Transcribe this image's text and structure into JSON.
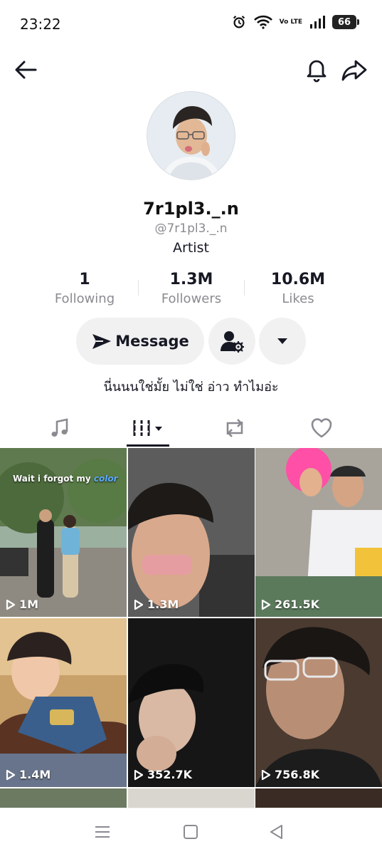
{
  "status_bar": {
    "time": "23:22",
    "network": "Vo LTE",
    "battery": "66"
  },
  "profile": {
    "display_name": "7r1pl3._.n",
    "username": "@7r1pl3._.n",
    "category": "Artist",
    "bio": "นี่นนนใช่มั้ย ไม่ใช่ อ่าว ทำไมอ่ะ"
  },
  "stats": [
    {
      "value": "1",
      "label": "Following"
    },
    {
      "value": "1.3M",
      "label": "Followers"
    },
    {
      "value": "10.6M",
      "label": "Likes"
    }
  ],
  "actions": {
    "message_label": "Message"
  },
  "tabs": [
    {
      "icon": "music-note-icon"
    },
    {
      "icon": "grid-icon",
      "active": true
    },
    {
      "icon": "repost-icon"
    },
    {
      "icon": "heart-icon"
    }
  ],
  "videos": [
    {
      "views": "1M",
      "overlay": "Wait i forgot my",
      "overlay_word": "color"
    },
    {
      "views": "1.3M"
    },
    {
      "views": "261.5K"
    },
    {
      "views": "1.4M"
    },
    {
      "views": "352.7K"
    },
    {
      "views": "756.8K"
    }
  ],
  "colors": {
    "text_primary": "#161823",
    "text_secondary": "#8a8b91",
    "button_bg": "#f1f1f2"
  }
}
